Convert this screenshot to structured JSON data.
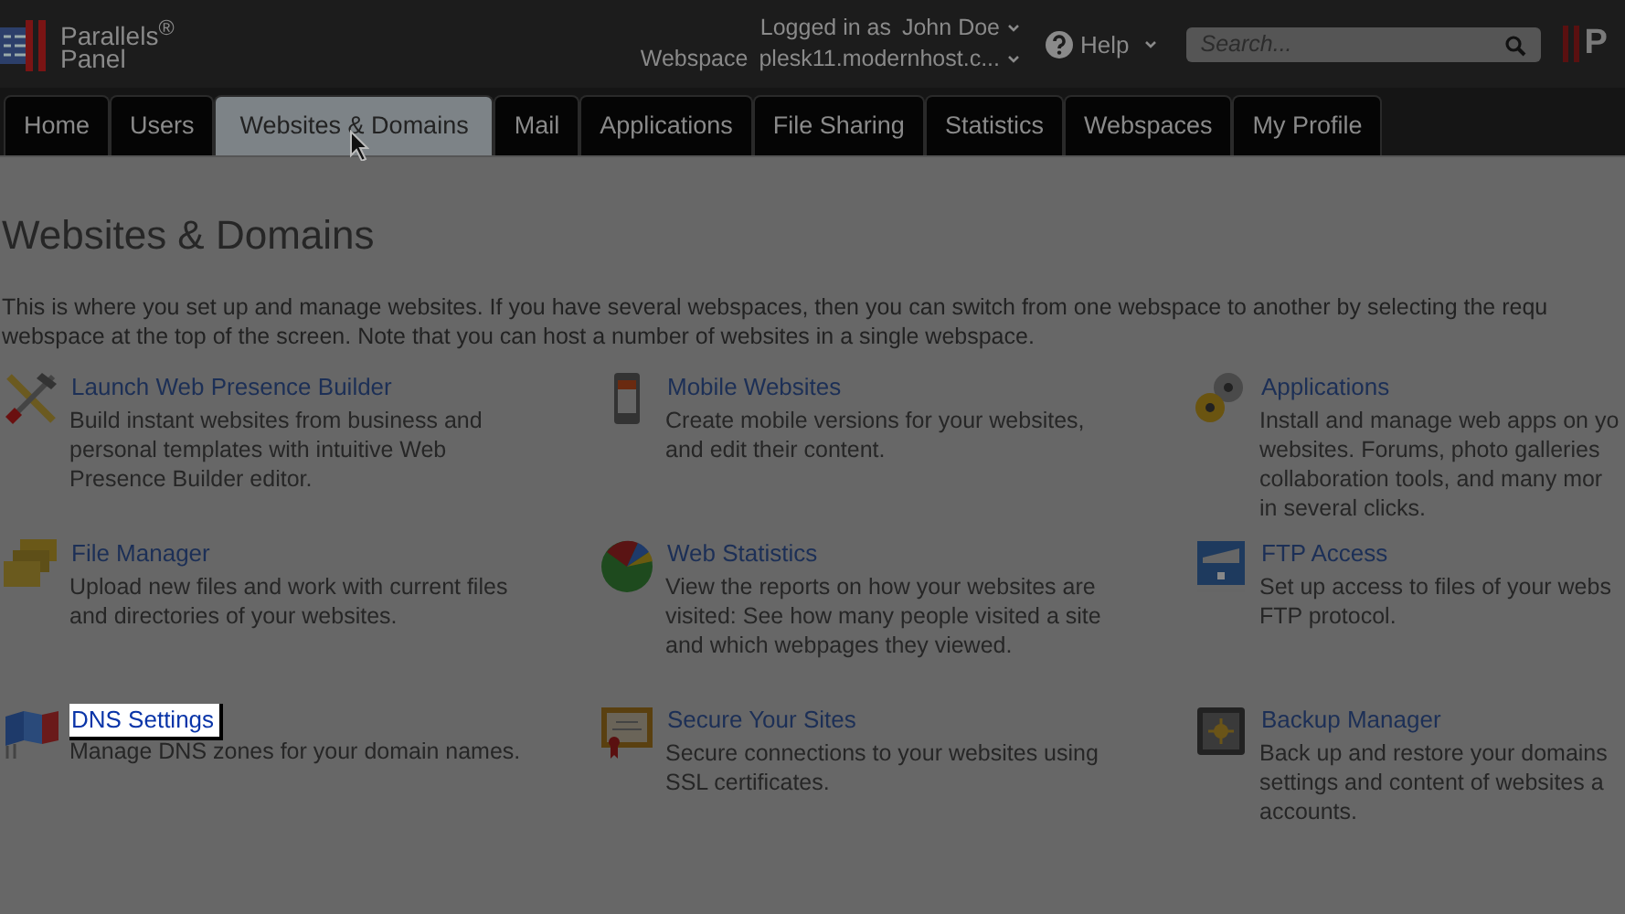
{
  "header": {
    "logo": "Parallels$^{®}$",
    "logo_sub": "Panel",
    "logged_in_label": "Logged in as",
    "user": "John Doe",
    "webspace_label": "Webspace",
    "webspace": "plesk11.modernhost.c...",
    "help": "Help",
    "search": {
      "placeholder": "Search..."
    },
    "right_logo": "P"
  },
  "tabs": [
    {
      "label": "Home",
      "selected": false
    },
    {
      "label": "Users",
      "selected": false
    },
    {
      "label": "Websites & Domains",
      "selected": true
    },
    {
      "label": "Mail",
      "selected": false
    },
    {
      "label": "Applications",
      "selected": false
    },
    {
      "label": "File Sharing",
      "selected": false
    },
    {
      "label": "Statistics",
      "selected": false
    },
    {
      "label": "Webspaces",
      "selected": false
    },
    {
      "label": "My Profile",
      "selected": false
    }
  ],
  "page": {
    "title": "Websites & Domains",
    "intro": [
      "This is where you set up and manage websites. If you have several webspaces, then you can switch from one webspace to another by selecting the requ",
      "webspace at the top of the screen. Note that you can host a number of websites in a single webspace."
    ]
  },
  "items": [
    {
      "kind": "builder",
      "title": "Launch Web Presence Builder",
      "lines": [
        "Build instant websites from business and",
        "personal templates with intuitive Web",
        "Presence Builder editor."
      ],
      "highlighted": false
    },
    {
      "kind": "mobile",
      "title": "Mobile Websites",
      "lines": [
        "Create mobile versions for your websites,",
        "and edit their content."
      ],
      "highlighted": false
    },
    {
      "kind": "apps",
      "title": "Applications",
      "lines": [
        "Install and manage web apps on yo",
        "websites. Forums, photo galleries",
        "collaboration tools, and many mor",
        "in several clicks."
      ],
      "highlighted": false
    },
    {
      "kind": "files",
      "title": "File Manager",
      "lines": [
        "Upload new files and work with current files",
        "and directories of your websites."
      ],
      "highlighted": false
    },
    {
      "kind": "stats",
      "title": "Web Statistics",
      "lines": [
        "View the reports on how your websites are",
        "visited: See how many people visited a site",
        "and which webpages they viewed."
      ],
      "highlighted": false
    },
    {
      "kind": "ftp",
      "title": "FTP Access",
      "lines": [
        "Set up access to files of your webs",
        "FTP protocol."
      ],
      "highlighted": false
    },
    {
      "kind": "dns",
      "title": "DNS Settings",
      "lines": [
        "Manage DNS zones for your domain names."
      ],
      "highlighted": true
    },
    {
      "kind": "ssl",
      "title": "Secure Your Sites",
      "lines": [
        "Secure connections to your websites using",
        "SSL certificates."
      ],
      "highlighted": false
    },
    {
      "kind": "backup",
      "title": "Backup Manager",
      "lines": [
        "Back up and restore your domains",
        "settings and content of websites a",
        "accounts."
      ],
      "highlighted": false
    }
  ]
}
